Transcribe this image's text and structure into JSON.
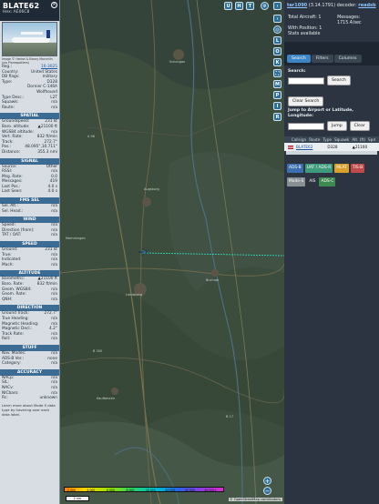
{
  "aircraft": {
    "callsign": "BLATE62",
    "hex_label": "Hex: AE06C8",
    "photo_credit": "Image © Heckel & Bovey Marcellin (via Planespotters)",
    "basic": [
      {
        "k": "Reg.:",
        "v": "16-3025",
        "link": true
      },
      {
        "k": "Country:",
        "v": "United States"
      },
      {
        "k": "DB flags:",
        "v": "military"
      },
      {
        "k": "Type:",
        "v": "D328"
      },
      {
        "k": "",
        "v": "Dornier C-146A"
      },
      {
        "k": "",
        "v": "Wolfhound"
      },
      {
        "k": "Type Desc.:",
        "v": "L2T"
      },
      {
        "k": "Squawk:",
        "v": "n/a"
      },
      {
        "k": "Route:",
        "v": "n/a"
      }
    ],
    "sections": [
      {
        "title": "SPATIAL",
        "rows": [
          {
            "k": "Groundspeed:",
            "v": "231 kt"
          },
          {
            "k": "Baro. altitude:",
            "v": "▲21100 ft"
          },
          {
            "k": "WGS84 altitude:",
            "v": "n/a"
          },
          {
            "k": "Vert. Rate:",
            "v": "832 ft/min"
          },
          {
            "k": "Track:",
            "v": "272.7°"
          },
          {
            "k": "Pos.:",
            "v": "48.095°,10.711°"
          },
          {
            "k": "Distance:",
            "v": "355.3 nmi"
          }
        ]
      },
      {
        "title": "SIGNAL",
        "rows": [
          {
            "k": "Source:",
            "v": "Other"
          },
          {
            "k": "RSSI:",
            "v": "n/a"
          },
          {
            "k": "Msg. Rate:",
            "v": "0.0"
          },
          {
            "k": "Messages:",
            "v": "419"
          },
          {
            "k": "Last Pos.:",
            "v": "4.0 s"
          },
          {
            "k": "Last Seen:",
            "v": "4.0 s"
          }
        ]
      },
      {
        "title": "FMS SEL",
        "rows": [
          {
            "k": "Sel. Alt.:",
            "v": "n/a"
          },
          {
            "k": "Sel. Head.:",
            "v": "n/a"
          }
        ]
      },
      {
        "title": "WIND",
        "rows": [
          {
            "k": "Speed:",
            "v": "n/a"
          },
          {
            "k": "Direction (from):",
            "v": "n/a"
          },
          {
            "k": "TAT / OAT:",
            "v": "n/a"
          }
        ]
      },
      {
        "title": "SPEED",
        "rows": [
          {
            "k": "Ground:",
            "v": "231 kt"
          },
          {
            "k": "True:",
            "v": "n/a"
          },
          {
            "k": "Indicated:",
            "v": "n/a"
          },
          {
            "k": "Mach:",
            "v": "n/a"
          }
        ]
      },
      {
        "title": "ALTITUDE",
        "rows": [
          {
            "k": "Barometric:",
            "v": "▲21100 ft"
          },
          {
            "k": "Baro. Rate:",
            "v": "832 ft/min"
          },
          {
            "k": "Geom. WGS84:",
            "v": "n/a"
          },
          {
            "k": "Geom. Rate:",
            "v": "n/a"
          },
          {
            "k": "QNH:",
            "v": "n/a"
          }
        ]
      },
      {
        "title": "DIRECTION",
        "rows": [
          {
            "k": "Ground Track:",
            "v": "272.7°"
          },
          {
            "k": "True Heading:",
            "v": "n/a"
          },
          {
            "k": "Magnetic Heading:",
            "v": "n/a"
          },
          {
            "k": "Magnetic Decl.:",
            "v": "4.2°"
          },
          {
            "k": "Track Rate:",
            "v": "n/a"
          },
          {
            "k": "Roll:",
            "v": "n/a"
          }
        ]
      },
      {
        "title": "STUFF",
        "rows": [
          {
            "k": "Nav. Modes:",
            "v": "n/a"
          },
          {
            "k": "ADS-B Ver.:",
            "v": "none"
          },
          {
            "k": "Category:",
            "v": "n/a"
          }
        ]
      },
      {
        "title": "ACCURACY",
        "rows": [
          {
            "k": "NACp:",
            "v": "n/a"
          },
          {
            "k": "SIL:",
            "v": "n/a"
          },
          {
            "k": "NACv:",
            "v": "n/a"
          },
          {
            "k": "NICbaro:",
            "v": "n/a"
          },
          {
            "k": "Rc:",
            "v": "unknown"
          }
        ]
      }
    ],
    "note": "Learn more about Mode S data type by hovering over each data label."
  },
  "map": {
    "top_buttons": [
      "U",
      "H",
      "T"
    ],
    "side_buttons": [
      "L",
      "O",
      "K",
      "M",
      "P",
      "I",
      "R"
    ],
    "zoom_in": "+",
    "zoom_out": "−",
    "labels": [
      "Augsburg",
      "Landsberg",
      "Kaufbeuren",
      "Memmingen",
      "Buchloe",
      "Schongau",
      "B 300",
      "B 17",
      "A 96"
    ],
    "colorbar_ticks": [
      "2 000",
      "4 000",
      "6 000",
      "8 000",
      "10 000",
      "20 000",
      "30 000",
      "40 000+"
    ],
    "scale": "2 nm",
    "attribution": "© OpenStreetMap contributors."
  },
  "right": {
    "version_name": "tar1090",
    "version_rest": " (3.14.1791) decoder: ",
    "decoder_link": "readsb",
    "total_aircraft": "Total Aircraft: 1",
    "messages_label": "Messages:",
    "messages_value": "1715.4/sec",
    "with_position": "With Position: 1",
    "stats": "Stats available",
    "tabs": [
      "Search",
      "Filters",
      "Columns"
    ],
    "search_label": "Search:",
    "search_button": "Search",
    "clear_search": "Clear Search",
    "jump_label": "Jump to Airport or Latitude, Longitude:",
    "jump_button": "Jump",
    "clear_button": "Clear",
    "columns": [
      "Callsign",
      "Route",
      "Type",
      "Squawk",
      "Alt. (ft)",
      "Spd"
    ],
    "row": {
      "callsign": "BLATE62",
      "type": "D328",
      "alt": "▲21100"
    },
    "sources": [
      {
        "label": "ADS-B",
        "color": "#3c6fb0"
      },
      {
        "label": "UAT / ADS-R",
        "color": "#3d9a7a"
      },
      {
        "label": "MLAT",
        "color": "#d9a02a"
      },
      {
        "label": "TIS-B",
        "color": "#c04a4a"
      },
      {
        "label": "Mode-S",
        "color": "#8a8f94"
      },
      {
        "label": "AIS",
        "color": "#2b3440"
      },
      {
        "label": "ADS-C",
        "color": "#3d8a52"
      }
    ]
  }
}
